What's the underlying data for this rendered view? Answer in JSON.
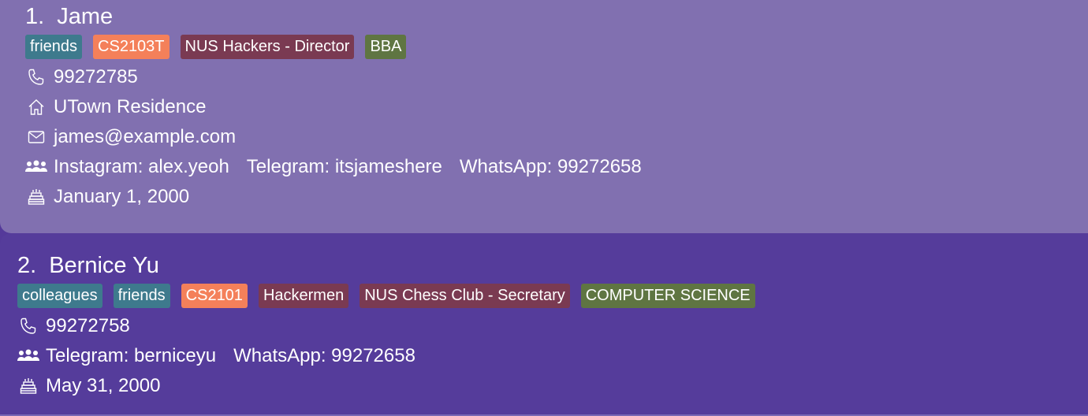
{
  "contacts": [
    {
      "index": "1.",
      "name": "Jame",
      "tags": [
        {
          "label": "friends",
          "color": "#3e7a8d"
        },
        {
          "label": "CS2103T",
          "color": "#f4805a"
        },
        {
          "label": "NUS Hackers - Director",
          "color": "#7a3a52"
        },
        {
          "label": "BBA",
          "color": "#5f7542"
        }
      ],
      "phone": "99272785",
      "address": "UTown Residence",
      "email": "james@example.com",
      "socials": [
        "Instagram: alex.yeoh",
        "Telegram: itsjameshere",
        "WhatsApp: 99272658"
      ],
      "birthday": "January 1, 2000",
      "background_color": "#8170b0"
    },
    {
      "index": "2.",
      "name": "Bernice Yu",
      "tags": [
        {
          "label": "colleagues",
          "color": "#3e7a8d"
        },
        {
          "label": "friends",
          "color": "#3e7a8d"
        },
        {
          "label": "CS2101",
          "color": "#f4805a"
        },
        {
          "label": "Hackermen",
          "color": "#7a3a52"
        },
        {
          "label": "NUS Chess Club - Secretary",
          "color": "#7a3a52"
        },
        {
          "label": "COMPUTER SCIENCE",
          "color": "#5f7542"
        }
      ],
      "phone": "99272758",
      "socials": [
        "Telegram: berniceyu",
        "WhatsApp: 99272658"
      ],
      "birthday": "May 31, 2000",
      "background_color": "#553c9b"
    }
  ],
  "icons": {
    "phone": "phone-icon",
    "address": "home-icon",
    "email": "mail-icon",
    "socials": "people-icon",
    "birthday": "cake-icon"
  }
}
